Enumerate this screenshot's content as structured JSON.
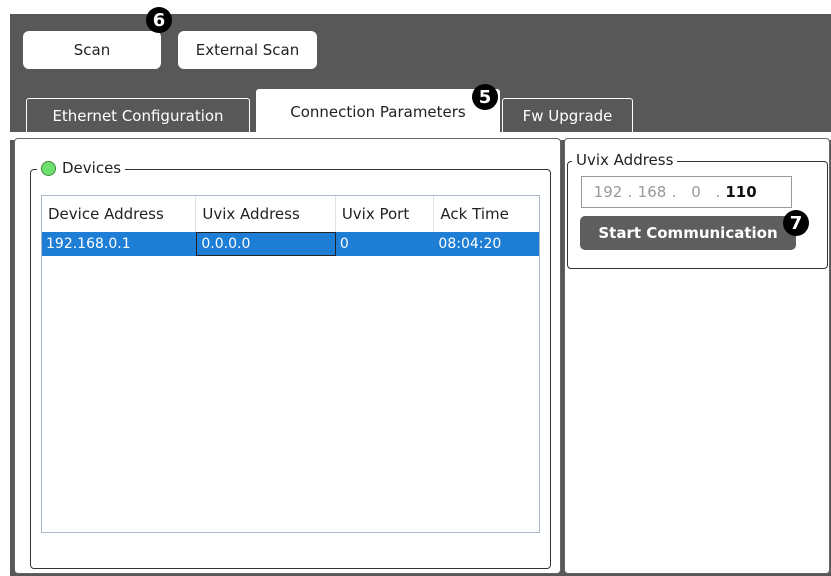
{
  "toolbar": {
    "scan_label": "Scan",
    "external_scan_label": "External Scan"
  },
  "tabs": [
    {
      "label": "Ethernet Configuration"
    },
    {
      "label": "Connection Parameters"
    },
    {
      "label": "Fw Upgrade"
    }
  ],
  "devices": {
    "title": "Devices",
    "status_color": "#6fe06f",
    "columns": [
      "Device Address",
      "Uvix Address",
      "Uvix Port",
      "Ack Time"
    ],
    "rows": [
      [
        "192.168.0.1",
        "0.0.0.0",
        "0",
        "08:04:20"
      ]
    ]
  },
  "uvix": {
    "title": "Uvix Address",
    "ip": [
      "192",
      "168",
      "0",
      "110"
    ],
    "start_label": "Start Communication"
  },
  "markers": {
    "m5": "5",
    "m6": "6",
    "m7": "7"
  },
  "colors": {
    "selection": "#1e7dd4",
    "background": "#585858"
  }
}
